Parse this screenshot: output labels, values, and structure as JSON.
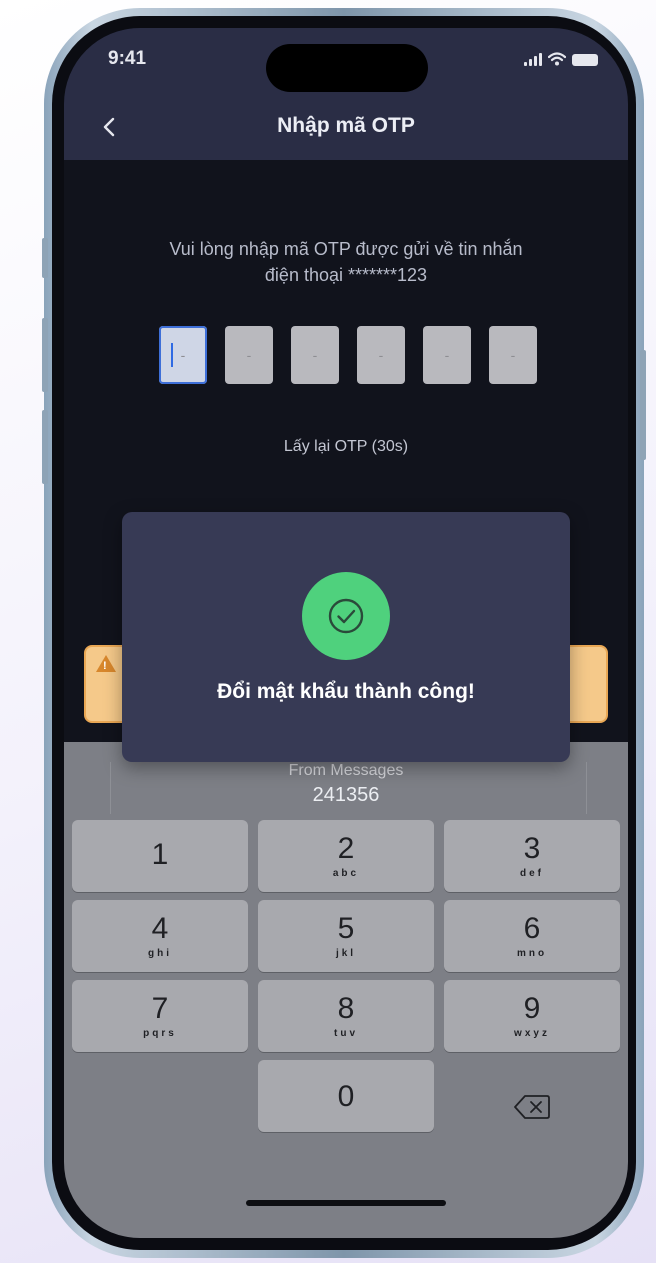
{
  "status": {
    "time": "9:41"
  },
  "nav": {
    "back_icon": "chevron-left-icon",
    "title": "Nhập mã OTP"
  },
  "main": {
    "instruction_line1": "Vui lòng nhập mã OTP được gửi về tin nhắn",
    "instruction_line2": "điện thoại *******123",
    "otp": {
      "placeholder": "-",
      "boxes": [
        "",
        "",
        "",
        "",
        "",
        ""
      ],
      "active_index": 0
    },
    "resend_text": "Lấy lại OTP (30s)"
  },
  "warning": {
    "icon": "warning-triangle-icon",
    "color": "#f5c98a"
  },
  "modal": {
    "icon": "check-circle-icon",
    "icon_color": "#4fd17d",
    "message": "Đổi mật khẩu thành công!"
  },
  "keyboard": {
    "suggestion_source": "From Messages",
    "suggestion_code": "241356",
    "keys": [
      {
        "num": "1",
        "letters": ""
      },
      {
        "num": "2",
        "letters": "abc"
      },
      {
        "num": "3",
        "letters": "def"
      },
      {
        "num": "4",
        "letters": "ghi"
      },
      {
        "num": "5",
        "letters": "jkl"
      },
      {
        "num": "6",
        "letters": "mno"
      },
      {
        "num": "7",
        "letters": "pqrs"
      },
      {
        "num": "8",
        "letters": "tuv"
      },
      {
        "num": "9",
        "letters": "wxyz"
      },
      {
        "num": "0",
        "letters": ""
      }
    ],
    "delete_icon": "backspace-icon"
  },
  "colors": {
    "accent": "#2f6ae3",
    "header_bg": "#2a2d45",
    "success": "#4fd17d"
  }
}
